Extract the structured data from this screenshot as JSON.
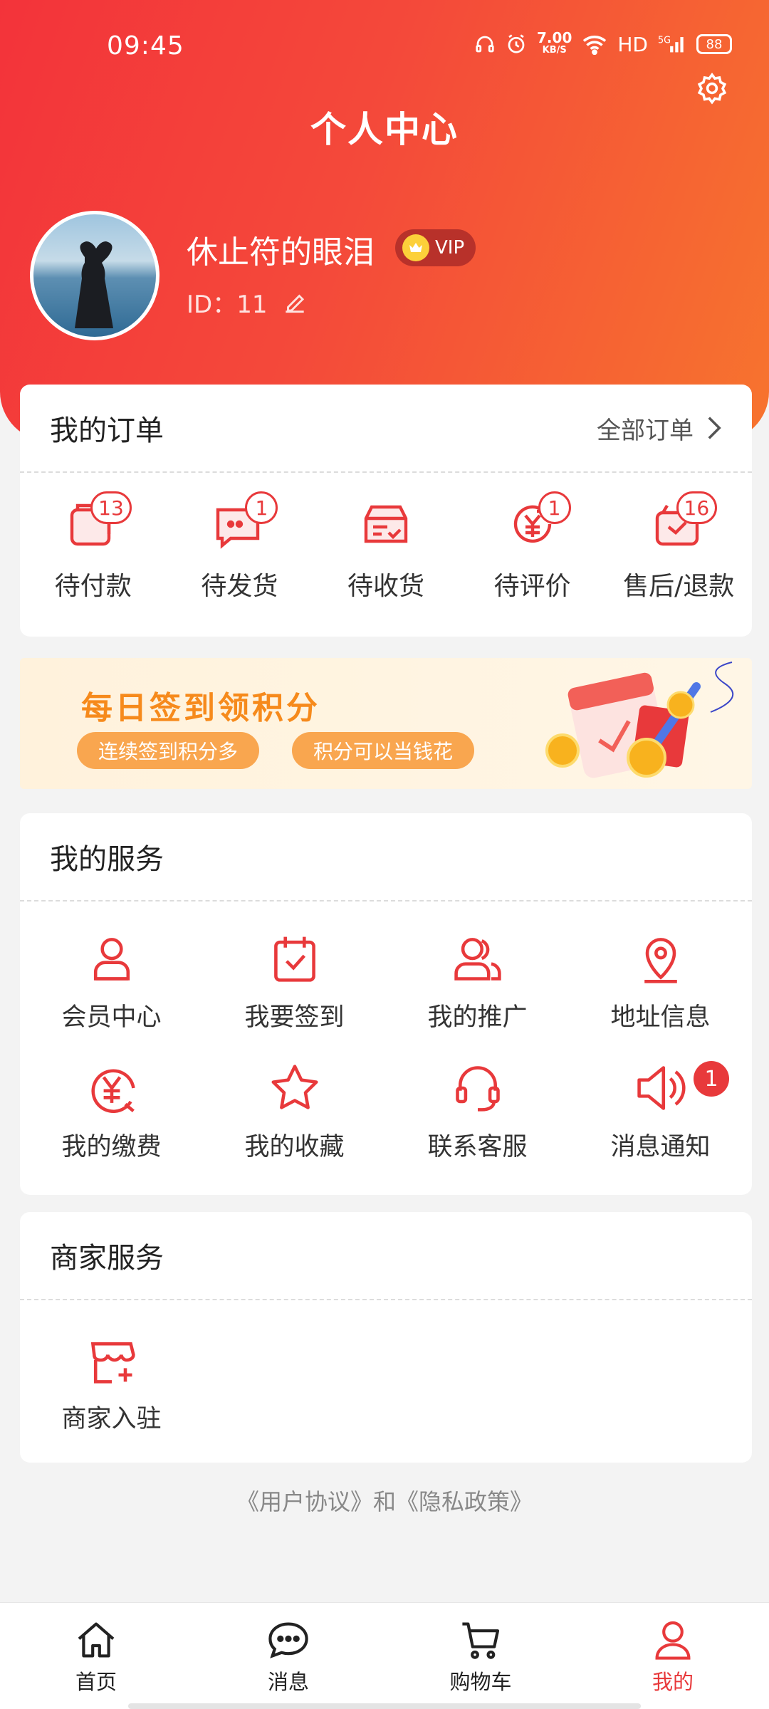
{
  "status_bar": {
    "time": "09:45",
    "speed": "7.00",
    "speed_unit": "KB/S",
    "hd": "HD",
    "network": "5G",
    "battery": "88"
  },
  "header": {
    "title": "个人中心"
  },
  "profile": {
    "nickname": "休止符的眼泪",
    "vip_label": "VIP",
    "id_text": "ID：11"
  },
  "orders": {
    "title": "我的订单",
    "all_label": "全部订单",
    "items": [
      {
        "label": "待付款",
        "badge": "13",
        "icon": "wallet-icon"
      },
      {
        "label": "待发货",
        "badge": "1",
        "icon": "chat-box-icon"
      },
      {
        "label": "待收货",
        "badge": "",
        "icon": "package-icon"
      },
      {
        "label": "待评价",
        "badge": "1",
        "icon": "yen-refresh-icon"
      },
      {
        "label": "售后/退款",
        "badge": "16",
        "icon": "return-box-icon"
      }
    ]
  },
  "banner": {
    "title": "每日签到领积分",
    "pill1": "连续签到积分多",
    "pill2": "积分可以当钱花"
  },
  "services": {
    "title": "我的服务",
    "items": [
      {
        "label": "会员中心",
        "icon": "user-icon"
      },
      {
        "label": "我要签到",
        "icon": "calendar-check-icon"
      },
      {
        "label": "我的推广",
        "icon": "users-icon"
      },
      {
        "label": "地址信息",
        "icon": "location-pin-icon"
      },
      {
        "label": "我的缴费",
        "icon": "yen-icon"
      },
      {
        "label": "我的收藏",
        "icon": "star-icon"
      },
      {
        "label": "联系客服",
        "icon": "headset-icon"
      },
      {
        "label": "消息通知",
        "icon": "speaker-icon",
        "badge": "1"
      }
    ]
  },
  "merchant": {
    "title": "商家服务",
    "items": [
      {
        "label": "商家入驻",
        "icon": "store-plus-icon"
      }
    ]
  },
  "footer_links": "《用户协议》和《隐私政策》",
  "tabbar": [
    {
      "label": "首页",
      "icon": "home-icon"
    },
    {
      "label": "消息",
      "icon": "message-icon"
    },
    {
      "label": "购物车",
      "icon": "cart-icon"
    },
    {
      "label": "我的",
      "icon": "profile-icon",
      "active": true
    }
  ],
  "colors": {
    "accent": "#e8393b",
    "header_start": "#f3333a",
    "header_end": "#f7742e",
    "banner_text": "#f68a1c"
  }
}
